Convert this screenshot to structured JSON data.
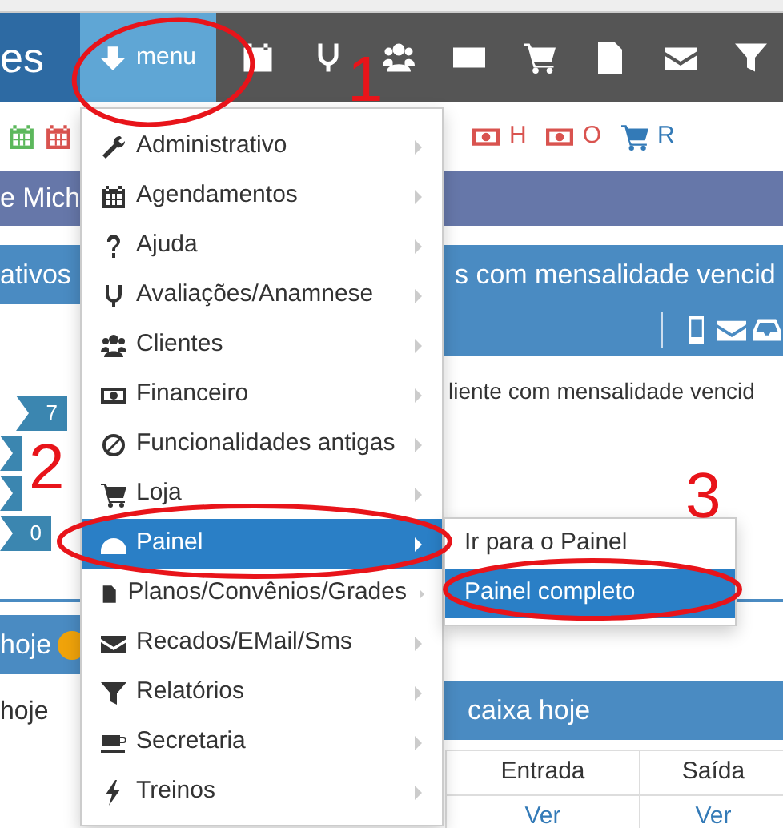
{
  "navbar": {
    "brand": "es",
    "menu_button": {
      "label": "menu",
      "selected": true
    }
  },
  "toolbar": {
    "letters": [
      "H",
      "O",
      "R"
    ]
  },
  "user_bar": {
    "text": "e Mich"
  },
  "left_panel": {
    "title": "ativos",
    "badges": [
      "7",
      "0"
    ],
    "today_title": "hoje",
    "today_text": "hoje"
  },
  "right_panel": {
    "title": "s com mensalidade vencid",
    "text": "liente com mensalidade vencid",
    "cash_title": "caixa hoje",
    "table": {
      "columns": [
        "Entrada",
        "Saída"
      ],
      "rows": [
        [
          "Ver",
          "Ver"
        ]
      ]
    }
  },
  "menu": {
    "items": [
      {
        "label": "Administrativo",
        "selected": false
      },
      {
        "label": "Agendamentos",
        "selected": false
      },
      {
        "label": "Ajuda",
        "selected": false
      },
      {
        "label": "Avaliações/Anamnese",
        "selected": false
      },
      {
        "label": "Clientes",
        "selected": false
      },
      {
        "label": "Financeiro",
        "selected": false
      },
      {
        "label": "Funcionalidades antigas",
        "selected": false
      },
      {
        "label": "Loja",
        "selected": false
      },
      {
        "label": "Painel",
        "selected": true
      },
      {
        "label": "Planos/Convênios/Grades",
        "selected": false
      },
      {
        "label": "Recados/EMail/Sms",
        "selected": false
      },
      {
        "label": "Relatórios",
        "selected": false
      },
      {
        "label": "Secretaria",
        "selected": false
      },
      {
        "label": "Treinos",
        "selected": false
      }
    ],
    "submenu": {
      "items": [
        {
          "label": "Ir para o Painel",
          "selected": false
        },
        {
          "label": "Painel completo",
          "selected": true
        }
      ]
    }
  },
  "annotations": [
    {
      "number": "1"
    },
    {
      "number": "2"
    },
    {
      "number": "3"
    }
  ]
}
